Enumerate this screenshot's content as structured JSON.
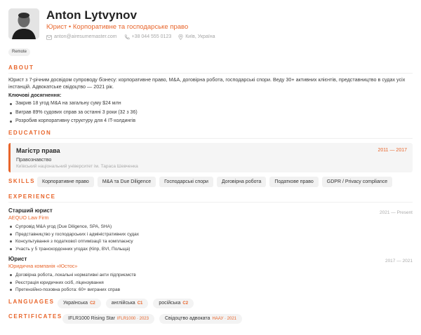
{
  "header": {
    "name": "Anton Lytvynov",
    "title": "Юрист • Корпоративне та господарське право",
    "contacts": {
      "email": "anton@airesumemaster.com",
      "phone": "+38 044 555 0123",
      "location": "Київ, Україна"
    }
  },
  "badge": "Remote",
  "about": {
    "heading": "ABOUT",
    "text": "Юрист з 7-річним досвідом супроводу бізнесу: корпоративне право, M&A, договірна робота, господарські спори. Веду 30+ активних клієнтів, представництво в судах усіх інстанцій. Адвокатське свідоцтво — 2021 рік.",
    "achievements_title": "Ключові досягнення:",
    "achievements": [
      "Закрив 18 угод M&A на загальну суму $24 млн",
      "Виграв 89% судових справ за останні 3 роки (32 з 36)",
      "Розробив корпоративну структуру для 4 IT-холдингів"
    ]
  },
  "education": {
    "heading": "EDUCATION",
    "degree": "Магістр права",
    "field": "Правознавство",
    "school": "Київський національний університет ім. Тараса Шевченка",
    "dates": "2011 — 2017"
  },
  "skills": {
    "heading": "SKILLS",
    "items": [
      "Корпоративне право",
      "M&A та Due Diligence",
      "Господарські спори",
      "Договірна робота",
      "Податкове право",
      "GDPR / Privacy compliance"
    ]
  },
  "experience": {
    "heading": "EXPERIENCE",
    "jobs": [
      {
        "title": "Старший юрист",
        "company": "AEQUO Law Firm",
        "dates": "2021 — Present",
        "duties": [
          "Супровід M&A угод (Due Diligence, SPA, SHA)",
          "Представництво у господарських і адміністративних судах",
          "Консультування з податкової оптимізації та комплаєнсу",
          "Участь у 5 транскордонних угодах (Кіпр, BVI, Польща)"
        ]
      },
      {
        "title": "Юрист",
        "company": "Юридична компанія «Юстос»",
        "dates": "2017 — 2021",
        "duties": [
          "Договірна робота, локальні нормативні акти підприємств",
          "Реєстрація юридичних осіб, ліцензування",
          "Претензійно-позовна робота: 60+ виграних справ"
        ]
      }
    ]
  },
  "languages": {
    "heading": "LANGUAGES",
    "items": [
      {
        "name": "Українська",
        "level": "C2"
      },
      {
        "name": "англійська",
        "level": "C1"
      },
      {
        "name": "російська",
        "level": "C2"
      }
    ]
  },
  "certificates": {
    "heading": "CERTIFICATES",
    "items": [
      {
        "name": "IFLR1000 Rising Star",
        "meta": "IFLR1000 · 2023"
      },
      {
        "name": "Свідоцтво адвоката",
        "meta": "НААУ · 2021"
      }
    ]
  },
  "colors": {
    "accent": "#e8652b",
    "muted": "#a5a5a5",
    "chip_bg": "#f1f1f1"
  }
}
